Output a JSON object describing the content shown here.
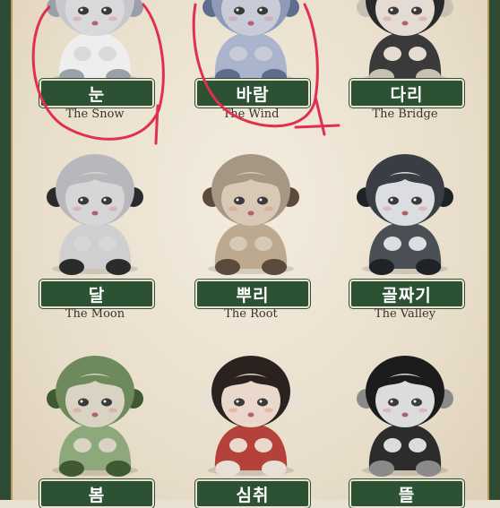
{
  "figures": [
    {
      "korean": "눈",
      "english": "The Snow",
      "icon": "snow-figure",
      "palette": {
        "head": "#d9d9dc",
        "hair": "#c8c8cc",
        "body": "#eeeeef",
        "accent": "#9aa0aa"
      }
    },
    {
      "korean": "바람",
      "english": "The Wind",
      "icon": "wind-figure",
      "palette": {
        "head": "#c9ccd8",
        "hair": "#8e9bb8",
        "body": "#aab4cc",
        "accent": "#5e6d8e"
      }
    },
    {
      "korean": "다리",
      "english": "The Bridge",
      "icon": "bridge-figure",
      "palette": {
        "head": "#e4dcd2",
        "hair": "#2a2a2a",
        "body": "#3a3a3a",
        "accent": "#c9c0b4"
      }
    },
    {
      "korean": "달",
      "english": "The Moon",
      "icon": "moon-figure",
      "palette": {
        "head": "#d6d6d6",
        "hair": "#b8b8bc",
        "body": "#cfcfd2",
        "accent": "#2b2b2b"
      }
    },
    {
      "korean": "뿌리",
      "english": "The Root",
      "icon": "root-figure",
      "palette": {
        "head": "#d8c9b6",
        "hair": "#a69684",
        "body": "#bda990",
        "accent": "#5a4b3d"
      }
    },
    {
      "korean": "골짜기",
      "english": "The Valley",
      "icon": "valley-figure",
      "palette": {
        "head": "#dcdde0",
        "hair": "#3a3e44",
        "body": "#4a4f56",
        "accent": "#1f2226"
      }
    },
    {
      "korean": "봄",
      "english": "",
      "icon": "spring-figure",
      "palette": {
        "head": "#d9d3c4",
        "hair": "#6e8a5c",
        "body": "#8da87a",
        "accent": "#3f5a33"
      }
    },
    {
      "korean": "심취",
      "english": "",
      "icon": "immersion-figure",
      "palette": {
        "head": "#ead8cc",
        "hair": "#2b2220",
        "body": "#b5423a",
        "accent": "#e6e0d6"
      }
    },
    {
      "korean": "뜰",
      "english": "",
      "icon": "garden-figure",
      "palette": {
        "head": "#dcdcdc",
        "hair": "#1c1c1c",
        "body": "#2c2c2c",
        "accent": "#8a8a8a"
      }
    }
  ],
  "colors": {
    "label_bg": "#2d5233",
    "frame": "#2f4a35",
    "scribble": "#e0304e",
    "paper": "#ece4d4"
  }
}
